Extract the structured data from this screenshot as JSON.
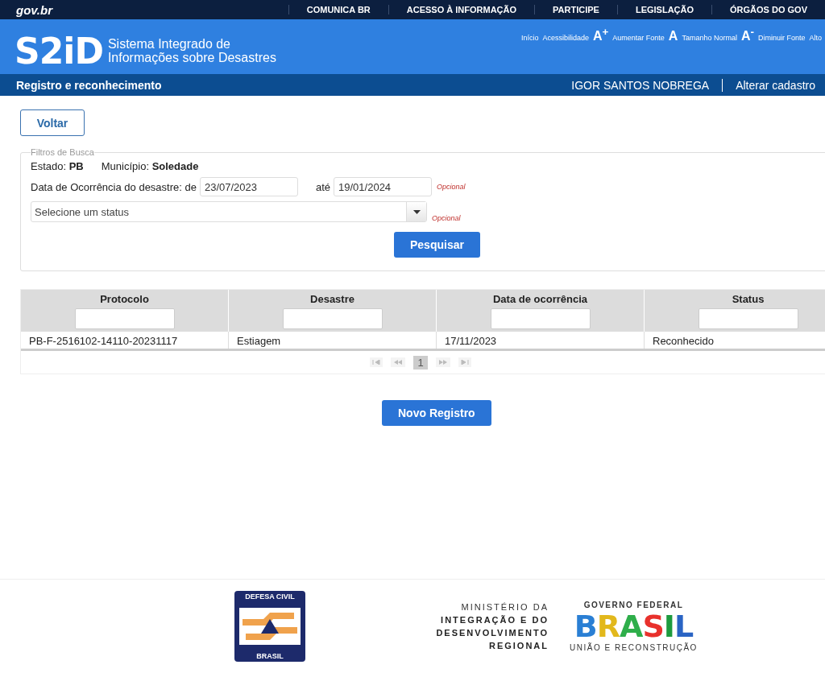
{
  "top_bar": {
    "logo": "gov.br",
    "links": [
      "COMUNICA BR",
      "ACESSO À INFORMAÇÃO",
      "PARTICIPE",
      "LEGISLAÇÃO",
      "ÓRGÃOS DO GOV"
    ]
  },
  "header": {
    "logo": "S2iD",
    "subtitle": [
      "Sistema Integrado de",
      "Informações sobre Desastres"
    ],
    "links": [
      {
        "label": "Início"
      },
      {
        "label": "Acessibilidade"
      },
      {
        "glyph": "A$^{+}$",
        "label": "Aumentar Fonte"
      },
      {
        "glyph": "A",
        "label": "Tamanho Normal"
      },
      {
        "glyph": "A$^{-}$",
        "label": "Diminuir Fonte"
      },
      {
        "label": "Alto"
      }
    ]
  },
  "sub_bar": {
    "title": "Registro e reconhecimento",
    "user": "IGOR SANTOS NOBREGA",
    "link": "Alterar cadastro"
  },
  "back_button": "Voltar",
  "filters": {
    "legend": "Filtros de Busca",
    "estado": "Estado: **PB**",
    "municipio": "Município: **Soledade**",
    "date_label": "Data de Ocorrência do desastre: de",
    "date_from": "23/07/2023",
    "until_label": "até",
    "date_to": "19/01/2024",
    "optional_date": "Opcional",
    "status_placeholder": "Selecione um status",
    "optional_status": "Opcional",
    "search_button": "Pesquisar"
  },
  "table": {
    "columns": [
      "Protocolo",
      "Desastre",
      "Data de ocorrência",
      "Status"
    ],
    "rows": [
      [
        "PB-F-2516102-14110-20231117",
        "Estiagem",
        "17/11/2023",
        "Reconhecido"
      ]
    ],
    "pages": [
      {
        "label": "1",
        "selected": true
      }
    ]
  },
  "new_button": "Novo Registro",
  "footer": {
    "defesa_civil": {
      "top": "DEFESA CIVIL",
      "bottom": "BRASIL"
    },
    "ministry": [
      "MINISTÉRIO DA",
      "INTEGRAÇÃO E DO",
      "DESENVOLVIMENTO",
      "REGIONAL"
    ],
    "government": {
      "top": "GOVERNO FEDERAL",
      "name": "BRASIL",
      "bottom": "UNIÃO E RECONSTRUÇÃO"
    }
  }
}
